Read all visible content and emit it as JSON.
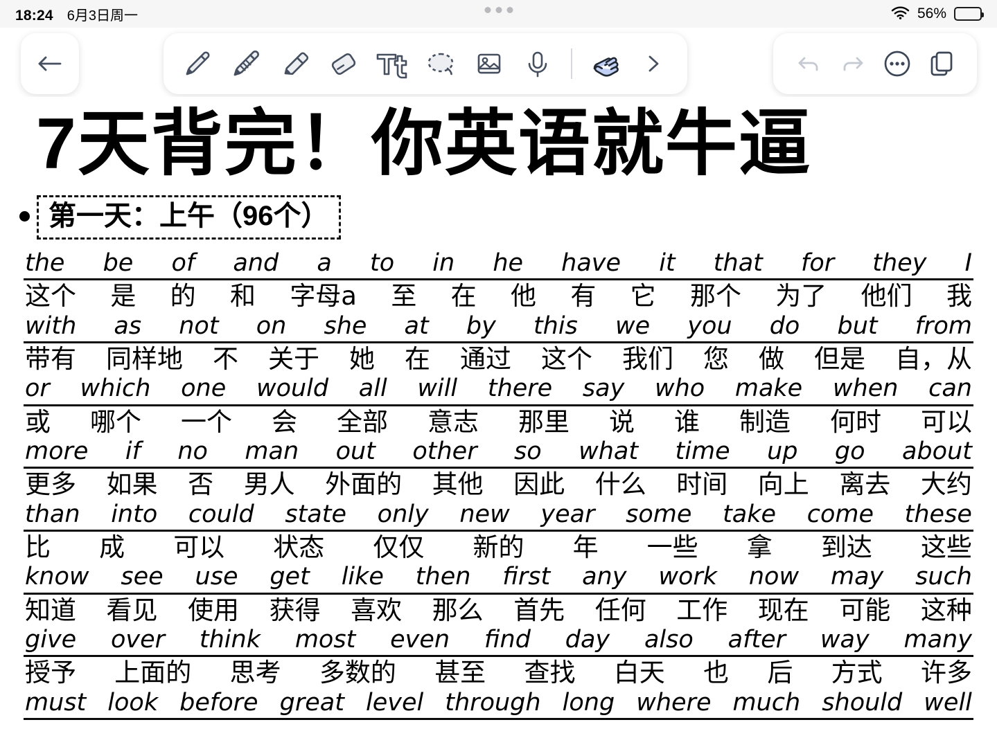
{
  "status_bar": {
    "time": "18:24",
    "date": "6月3日周一",
    "battery_percent": "56%",
    "wifi_icon": "wifi-icon",
    "battery_icon": "battery-icon"
  },
  "toolbar": {
    "back_icon": "arrow-left-icon",
    "tools": [
      {
        "name": "pen-tool",
        "icon": "pen-icon",
        "active": false
      },
      {
        "name": "pencil-tool",
        "icon": "pencil-icon",
        "active": false
      },
      {
        "name": "highlighter-tool",
        "icon": "highlighter-icon",
        "active": false
      },
      {
        "name": "eraser-tool",
        "icon": "eraser-icon",
        "active": false
      },
      {
        "name": "text-tool",
        "icon": "text-tt-icon",
        "active": false
      },
      {
        "name": "lasso-tool",
        "icon": "lasso-icon",
        "active": false
      },
      {
        "name": "image-tool",
        "icon": "image-icon",
        "active": false
      },
      {
        "name": "audio-tool",
        "icon": "microphone-icon",
        "active": false
      },
      {
        "name": "hand-tool",
        "icon": "hand-icon",
        "active": true
      },
      {
        "name": "expand-tools",
        "icon": "chevron-right-icon",
        "active": false
      }
    ],
    "actions": [
      {
        "name": "undo-button",
        "icon": "undo-icon",
        "disabled": true
      },
      {
        "name": "redo-button",
        "icon": "redo-icon",
        "disabled": true
      },
      {
        "name": "more-button",
        "icon": "ellipsis-circle-icon",
        "disabled": false
      },
      {
        "name": "pages-button",
        "icon": "pages-icon",
        "disabled": false
      }
    ]
  },
  "note": {
    "title": "7天背完！你英语就牛逼",
    "subtitle": "第一天：上午（96个）",
    "rows": [
      {
        "en": [
          "the",
          "be",
          "of",
          "and",
          "a",
          "to",
          "in",
          "he",
          "have",
          "it",
          "that",
          "for",
          "they",
          "I"
        ],
        "cn": [
          "这个",
          "是",
          "的",
          "和",
          "字母a",
          "至",
          "在",
          "他",
          "有",
          "它",
          "那个",
          "为了",
          "他们",
          "我"
        ]
      },
      {
        "en": [
          "with",
          "as",
          "not",
          "on",
          "she",
          "at",
          "by",
          "this",
          "we",
          "you",
          "do",
          "but",
          "from"
        ],
        "cn": [
          "带有",
          "同样地",
          "不",
          "关于",
          "她",
          "在",
          "通过",
          "这个",
          "我们",
          "您",
          "做",
          "但是",
          "自，从"
        ]
      },
      {
        "en": [
          "or",
          "which",
          "one",
          "would",
          "all",
          "will",
          "there",
          "say",
          "who",
          "make",
          "when",
          "can"
        ],
        "cn": [
          "或",
          "哪个",
          "一个",
          "会",
          "全部",
          "意志",
          "那里",
          "说",
          "谁",
          "制造",
          "何时",
          "可以"
        ]
      },
      {
        "en": [
          "more",
          "if",
          "no",
          "man",
          "out",
          "other",
          "so",
          "what",
          "time",
          "up",
          "go",
          "about"
        ],
        "cn": [
          "更多",
          "如果",
          "否",
          "男人",
          "外面的",
          "其他",
          "因此",
          "什么",
          "时间",
          "向上",
          "离去",
          "大约"
        ]
      },
      {
        "en": [
          "than",
          "into",
          "could",
          "state",
          "only",
          "new",
          "year",
          "some",
          "take",
          "come",
          "these"
        ],
        "cn": [
          "比",
          "成",
          "可以",
          "状态",
          "仅仅",
          "新的",
          "年",
          "一些",
          "拿",
          "到达",
          "这些"
        ]
      },
      {
        "en": [
          "know",
          "see",
          "use",
          "get",
          "like",
          "then",
          "first",
          "any",
          "work",
          "now",
          "may",
          "such"
        ],
        "cn": [
          "知道",
          "看见",
          "使用",
          "获得",
          "喜欢",
          "那么",
          "首先",
          "任何",
          "工作",
          "现在",
          "可能",
          "这种"
        ]
      },
      {
        "en": [
          "give",
          "over",
          "think",
          "most",
          "even",
          "find",
          "day",
          "also",
          "after",
          "way",
          "many"
        ],
        "cn": [
          "授予",
          "上面的",
          "思考",
          "多数的",
          "甚至",
          "查找",
          "白天",
          "也",
          "后",
          "方式",
          "许多"
        ]
      },
      {
        "en": [
          "must",
          "look",
          "before",
          "great",
          "level",
          "through",
          "long",
          "where",
          "much",
          "should",
          "well"
        ],
        "cn": []
      }
    ]
  },
  "colors": {
    "icon": "#454f5f",
    "icon_disabled": "#c5c9d1",
    "accent": "#c3d0f5",
    "ink": "#000000",
    "chrome": "#f6f6f6"
  }
}
